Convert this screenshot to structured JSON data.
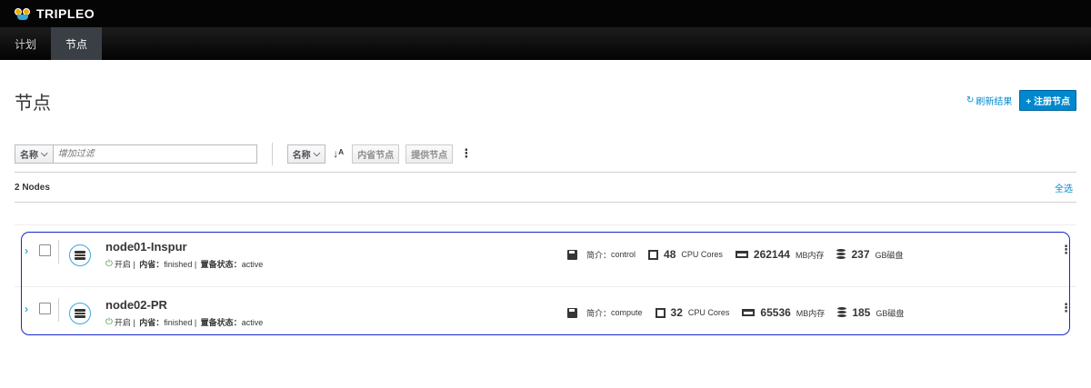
{
  "app": {
    "brand": "TRIPLEO"
  },
  "nav": {
    "tabs": [
      {
        "label": "计划"
      },
      {
        "label": "节点"
      }
    ]
  },
  "page": {
    "title": "节点",
    "refresh_label": "刷新结果",
    "register_label": "+ 注册节点"
  },
  "toolbar": {
    "filter_field": "名称",
    "filter_placeholder": "增加过滤",
    "sort_field": "名称",
    "sort_icon": "sort-alpha-asc-icon",
    "introspect_label": "内省节点",
    "provide_label": "提供节点"
  },
  "summary": {
    "count_label": "2 Nodes",
    "select_all": "全选"
  },
  "nodes": [
    {
      "name": "node01-Inspur",
      "power": "开启",
      "introspect_key": "内省：",
      "introspect_value": "finished",
      "provision_key": "置备状态：",
      "provision_value": "active",
      "profile_key": "简介：",
      "profile_value": "control",
      "cpu": "48",
      "cpu_unit": "CPU Cores",
      "mem": "262144",
      "mem_unit": "MB内存",
      "disk": "237",
      "disk_unit": "GB磁盘"
    },
    {
      "name": "node02-PR",
      "power": "开启",
      "introspect_key": "内省：",
      "introspect_value": "finished",
      "provision_key": "置备状态：",
      "provision_value": "active",
      "profile_key": "简介：",
      "profile_value": "compute",
      "cpu": "32",
      "cpu_unit": "CPU Cores",
      "mem": "65536",
      "mem_unit": "MB内存",
      "disk": "185",
      "disk_unit": "GB磁盘"
    }
  ],
  "colors": {
    "accent": "#0088ce",
    "highlight": "#1a27c9",
    "power_on": "#3f9c35"
  }
}
